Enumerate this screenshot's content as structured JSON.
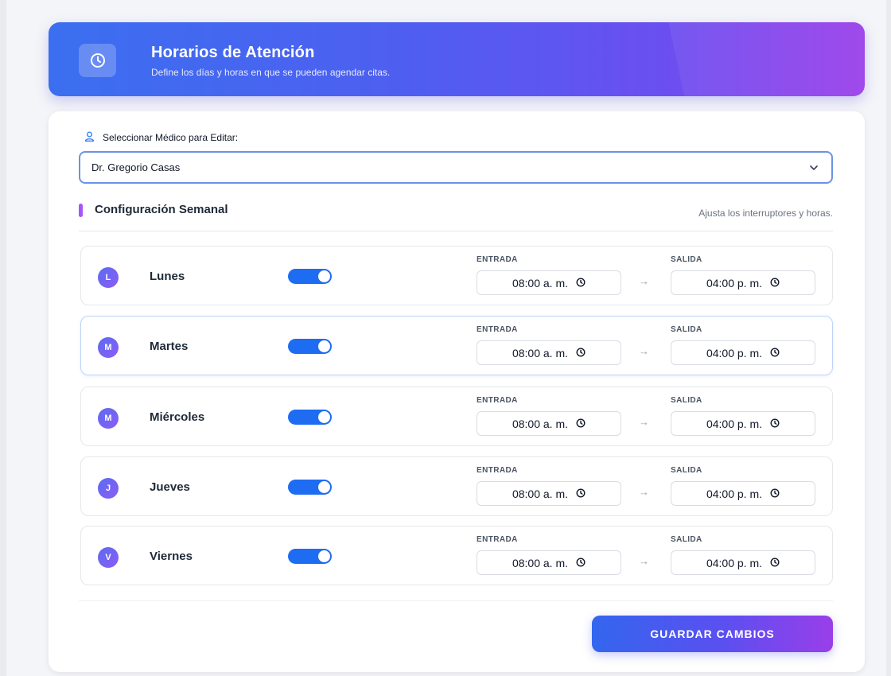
{
  "header": {
    "title": "Horarios de Atención",
    "subtitle": "Define los días y horas en que se pueden agendar citas."
  },
  "doctor_select": {
    "label": "Seleccionar Médico para Editar:",
    "value": "Dr. Gregorio Casas"
  },
  "section": {
    "title": "Configuración Semanal",
    "hint": "Ajusta los interruptores y horas."
  },
  "fields": {
    "entrada_label": "ENTRADA",
    "salida_label": "SALIDA",
    "arrow": "→"
  },
  "days": [
    {
      "initial": "L",
      "name": "Lunes",
      "enabled": true,
      "entrada": "08:00 a. m.",
      "salida": "04:00 p. m."
    },
    {
      "initial": "M",
      "name": "Martes",
      "enabled": true,
      "entrada": "08:00 a. m.",
      "salida": "04:00 p. m."
    },
    {
      "initial": "M",
      "name": "Miércoles",
      "enabled": true,
      "entrada": "08:00 a. m.",
      "salida": "04:00 p. m."
    },
    {
      "initial": "J",
      "name": "Jueves",
      "enabled": true,
      "entrada": "08:00 a. m.",
      "salida": "04:00 p. m."
    },
    {
      "initial": "V",
      "name": "Viernes",
      "enabled": true,
      "entrada": "08:00 a. m.",
      "salida": "04:00 p. m."
    }
  ],
  "actions": {
    "save_label": "GUARDAR CAMBIOS"
  },
  "colors": {
    "accent": "#1d6cf2",
    "gradient_start": "#3b6ff0",
    "gradient_end": "#9a3ee9",
    "section_marker": "#a855f7"
  },
  "icons": {
    "banner": "clock-icon",
    "select_label": "user-icon",
    "select_chevron": "chevron-down-icon",
    "time_field": "clock-icon"
  }
}
